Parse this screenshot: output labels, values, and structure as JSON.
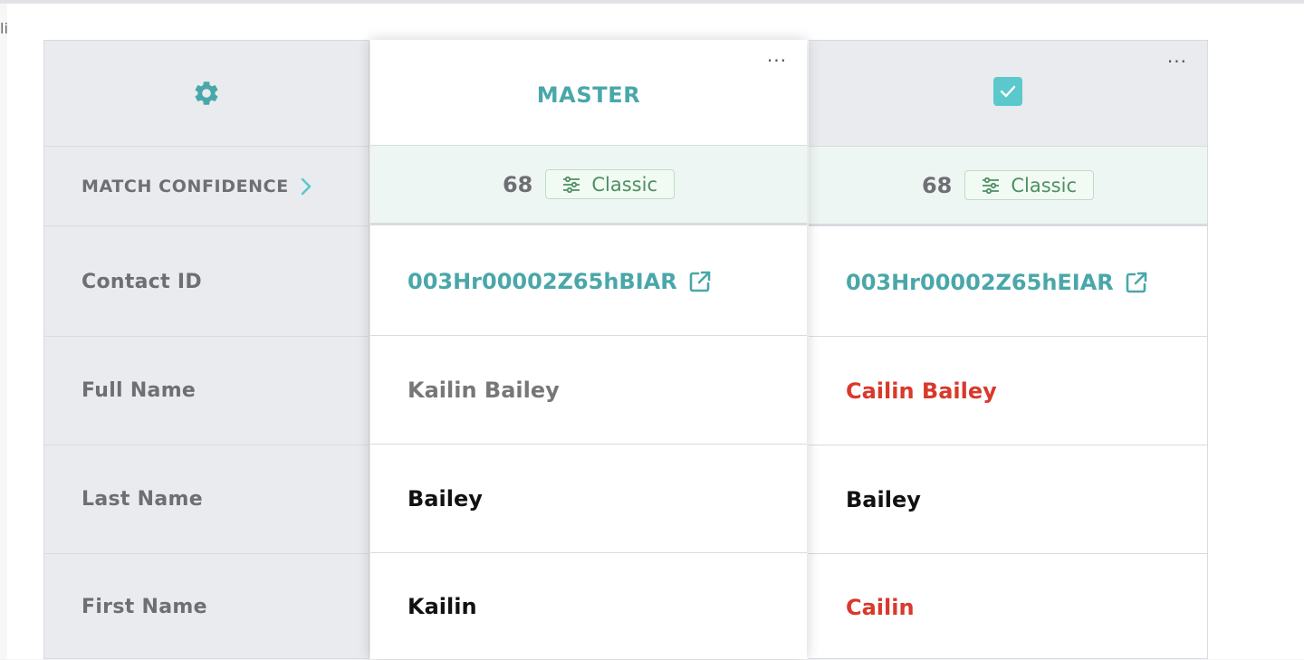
{
  "labels": {
    "match_confidence": "MATCH CONFIDENCE",
    "contact_id": "Contact ID",
    "full_name": "Full Name",
    "last_name": "Last Name",
    "first_name": "First Name"
  },
  "master": {
    "title": "MASTER",
    "menu": "···",
    "score": "68",
    "mode": "Classic",
    "contact_id": "003Hr00002Z65hBIAR",
    "full_name": "Kailin Bailey",
    "last_name": "Bailey",
    "first_name": "Kailin"
  },
  "second": {
    "menu": "···",
    "checked": true,
    "score": "68",
    "mode": "Classic",
    "contact_id": "003Hr00002Z65hEIAR",
    "full_name": "Cailin Bailey",
    "last_name": "Bailey",
    "first_name": "Cailin"
  },
  "colors": {
    "accent": "#4aa7a9",
    "different": "#d9392b",
    "badge_green": "#4f8f63"
  },
  "icons": {
    "settings": "gear-icon",
    "expand": "chevron-right-icon",
    "external": "external-link-icon",
    "mode": "sliders-icon",
    "selected": "checkbox-checked-icon"
  }
}
